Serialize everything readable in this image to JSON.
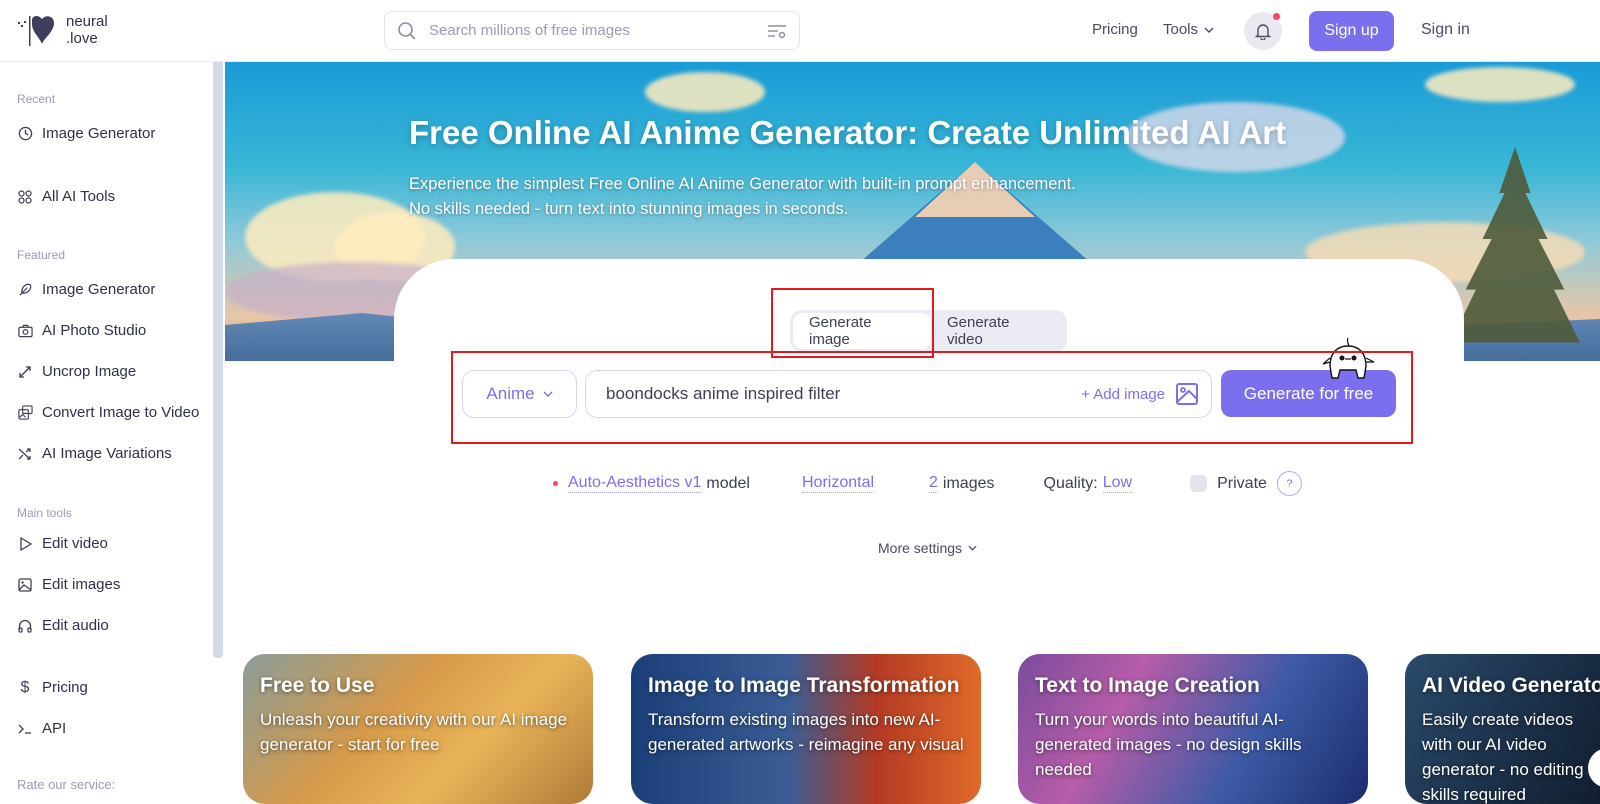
{
  "header": {
    "logo_line1": "neural",
    "logo_line2": ".love",
    "search_placeholder": "Search millions of free images",
    "nav_pricing": "Pricing",
    "nav_tools": "Tools",
    "signup_label": "Sign up",
    "signin_label": "Sign in",
    "accent_color": "#7b6ff0"
  },
  "sidebar": {
    "sections": {
      "recent": "Recent",
      "featured": "Featured",
      "main_tools": "Main tools",
      "rate": "Rate our service:"
    },
    "recent_items": [
      {
        "label": "Image Generator",
        "icon": "clock-icon"
      }
    ],
    "all_tools": {
      "label": "All AI Tools",
      "icon": "grid-icon"
    },
    "featured_items": [
      {
        "label": "Image Generator",
        "icon": "feather-icon"
      },
      {
        "label": "AI Photo Studio",
        "icon": "camera-icon"
      },
      {
        "label": "Uncrop Image",
        "icon": "expand-icon"
      },
      {
        "label": "Convert Image to Video",
        "icon": "image-video-icon"
      },
      {
        "label": "AI Image Variations",
        "icon": "shuffle-icon"
      }
    ],
    "main_tools_items": [
      {
        "label": "Edit video",
        "icon": "play-icon"
      },
      {
        "label": "Edit images",
        "icon": "image-icon"
      },
      {
        "label": "Edit audio",
        "icon": "headphones-icon"
      }
    ],
    "bottom_items": [
      {
        "label": "Pricing",
        "icon": "dollar-icon"
      },
      {
        "label": "API",
        "icon": "terminal-icon"
      }
    ]
  },
  "hero": {
    "title": "Free Online AI Anime Generator: Create Unlimited AI Art",
    "subtitle_line1": "Experience the simplest Free Online AI Anime Generator with built-in prompt enhancement.",
    "subtitle_line2": "No skills needed - turn text into stunning images in seconds."
  },
  "generator": {
    "tabs": [
      {
        "label": "Generate image",
        "active": true
      },
      {
        "label": "Generate video",
        "active": false
      }
    ],
    "style_value": "Anime",
    "prompt_value": "boondocks anime inspired filter",
    "add_image_label": "+ Add image",
    "generate_label": "Generate for free",
    "options": {
      "model_link": "Auto-Aesthetics v1",
      "model_suffix": "model",
      "orientation": "Horizontal",
      "image_count": "2",
      "image_count_suffix": "images",
      "quality_label": "Quality:",
      "quality_value": "Low",
      "private_label": "Private",
      "help_label": "?"
    },
    "more_settings_label": "More settings"
  },
  "feature_cards": [
    {
      "title": "Free to Use",
      "description": "Unleash your creativity with our AI image generator - start for free"
    },
    {
      "title": "Image to Image Transformation",
      "description": "Transform existing images into new AI-generated artworks - reimagine any visual"
    },
    {
      "title": "Text to Image Creation",
      "description": "Turn your words into beautiful AI-generated images - no design skills needed"
    },
    {
      "title": "AI Video Generator",
      "description": "Easily create videos with our AI video generator - no editing skills required"
    }
  ]
}
